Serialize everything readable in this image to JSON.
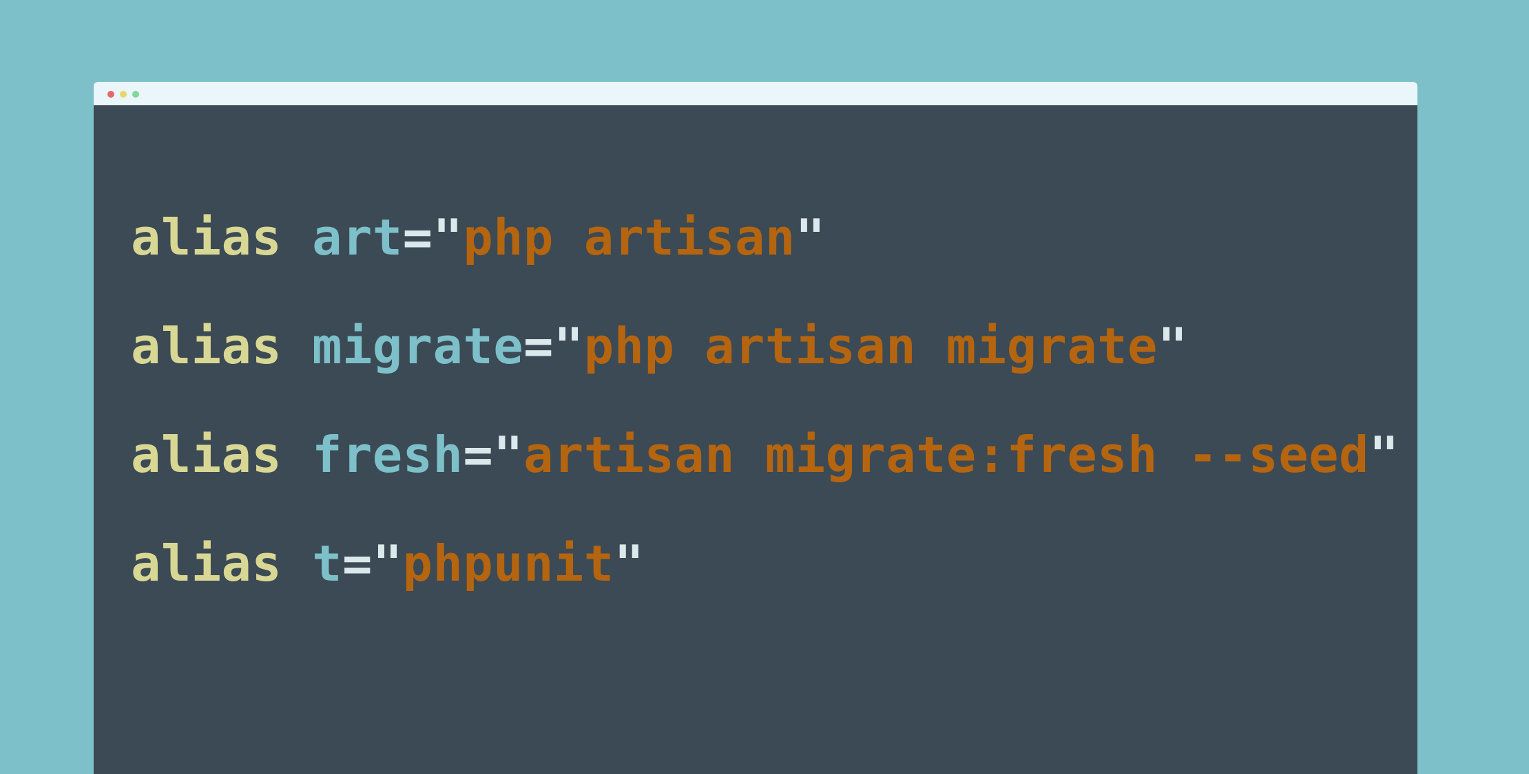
{
  "colors": {
    "background": "#7dc0c9",
    "window_bg": "#3b4a54",
    "titlebar_bg": "#eaf6f9",
    "keyword": "#d9d794",
    "name": "#7dc0c9",
    "punct": "#dbe8ec",
    "string": "#b5650f",
    "dot_red": "#e26a6a",
    "dot_yellow": "#e6d96b",
    "dot_green": "#7ed89a"
  },
  "window": {
    "dots": [
      "close-dot",
      "minimize-dot",
      "maximize-dot"
    ]
  },
  "code": {
    "lines": [
      {
        "keyword": "alias",
        "name": "art",
        "open": "=\"",
        "value": "php artisan",
        "close": "\""
      },
      {
        "keyword": "alias",
        "name": "migrate",
        "open": "=\"",
        "value": "php artisan migrate",
        "close": "\""
      },
      {
        "keyword": "alias",
        "name": "fresh",
        "open": "=\"",
        "value": "artisan migrate:fresh --seed",
        "close": "\""
      },
      {
        "keyword": "alias",
        "name": "t",
        "open": "=\"",
        "value": "phpunit",
        "close": "\""
      }
    ]
  }
}
